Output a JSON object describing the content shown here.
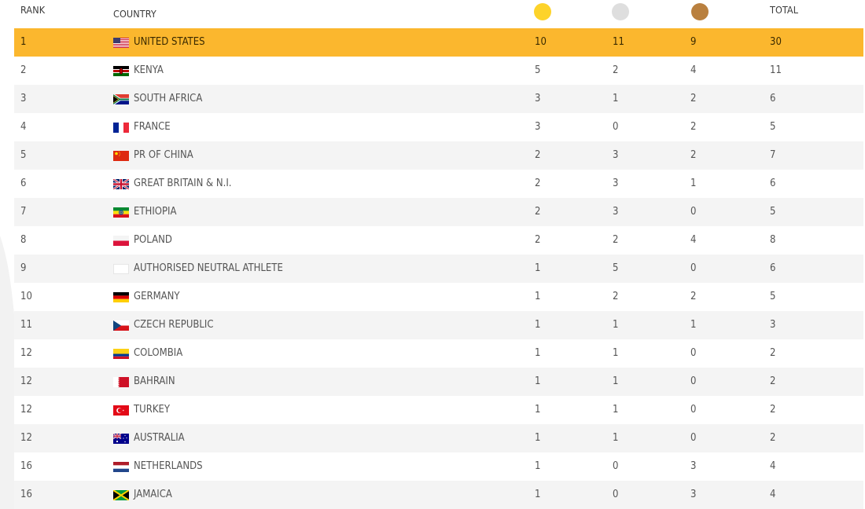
{
  "header": {
    "rank_label": "RANK",
    "country_label": "COUNTRY",
    "total_label": "TOTAL",
    "medal_colors": {
      "gold": "#fdd32a",
      "silver": "#dedede",
      "bronze": "#b9803f"
    }
  },
  "accent_color": "#fbb72e",
  "rows": [
    {
      "rank": "1",
      "country": "UNITED STATES",
      "flag": "usa-flag",
      "gold": "10",
      "silver": "11",
      "bronze": "9",
      "total": "30"
    },
    {
      "rank": "2",
      "country": "KENYA",
      "flag": "kenya-flag",
      "gold": "5",
      "silver": "2",
      "bronze": "4",
      "total": "11"
    },
    {
      "rank": "3",
      "country": "SOUTH AFRICA",
      "flag": "south-africa-flag",
      "gold": "3",
      "silver": "1",
      "bronze": "2",
      "total": "6"
    },
    {
      "rank": "4",
      "country": "FRANCE",
      "flag": "france-flag",
      "gold": "3",
      "silver": "0",
      "bronze": "2",
      "total": "5"
    },
    {
      "rank": "5",
      "country": "PR OF CHINA",
      "flag": "china-flag",
      "gold": "2",
      "silver": "3",
      "bronze": "2",
      "total": "7"
    },
    {
      "rank": "6",
      "country": "GREAT BRITAIN & N.I.",
      "flag": "great-britain-flag",
      "gold": "2",
      "silver": "3",
      "bronze": "1",
      "total": "6"
    },
    {
      "rank": "7",
      "country": "ETHIOPIA",
      "flag": "ethiopia-flag",
      "gold": "2",
      "silver": "3",
      "bronze": "0",
      "total": "5"
    },
    {
      "rank": "8",
      "country": "POLAND",
      "flag": "poland-flag",
      "gold": "2",
      "silver": "2",
      "bronze": "4",
      "total": "8"
    },
    {
      "rank": "9",
      "country": "AUTHORISED NEUTRAL ATHLETE",
      "flag": "blank-flag",
      "gold": "1",
      "silver": "5",
      "bronze": "0",
      "total": "6"
    },
    {
      "rank": "10",
      "country": "GERMANY",
      "flag": "germany-flag",
      "gold": "1",
      "silver": "2",
      "bronze": "2",
      "total": "5"
    },
    {
      "rank": "11",
      "country": "CZECH REPUBLIC",
      "flag": "czech-flag",
      "gold": "1",
      "silver": "1",
      "bronze": "1",
      "total": "3"
    },
    {
      "rank": "12",
      "country": "COLOMBIA",
      "flag": "colombia-flag",
      "gold": "1",
      "silver": "1",
      "bronze": "0",
      "total": "2"
    },
    {
      "rank": "12",
      "country": "BAHRAIN",
      "flag": "bahrain-flag",
      "gold": "1",
      "silver": "1",
      "bronze": "0",
      "total": "2"
    },
    {
      "rank": "12",
      "country": "TURKEY",
      "flag": "turkey-flag",
      "gold": "1",
      "silver": "1",
      "bronze": "0",
      "total": "2"
    },
    {
      "rank": "12",
      "country": "AUSTRALIA",
      "flag": "australia-flag",
      "gold": "1",
      "silver": "1",
      "bronze": "0",
      "total": "2"
    },
    {
      "rank": "16",
      "country": "NETHERLANDS",
      "flag": "netherlands-flag",
      "gold": "1",
      "silver": "0",
      "bronze": "3",
      "total": "4"
    },
    {
      "rank": "16",
      "country": "JAMAICA",
      "flag": "jamaica-flag",
      "gold": "1",
      "silver": "0",
      "bronze": "3",
      "total": "4"
    }
  ]
}
